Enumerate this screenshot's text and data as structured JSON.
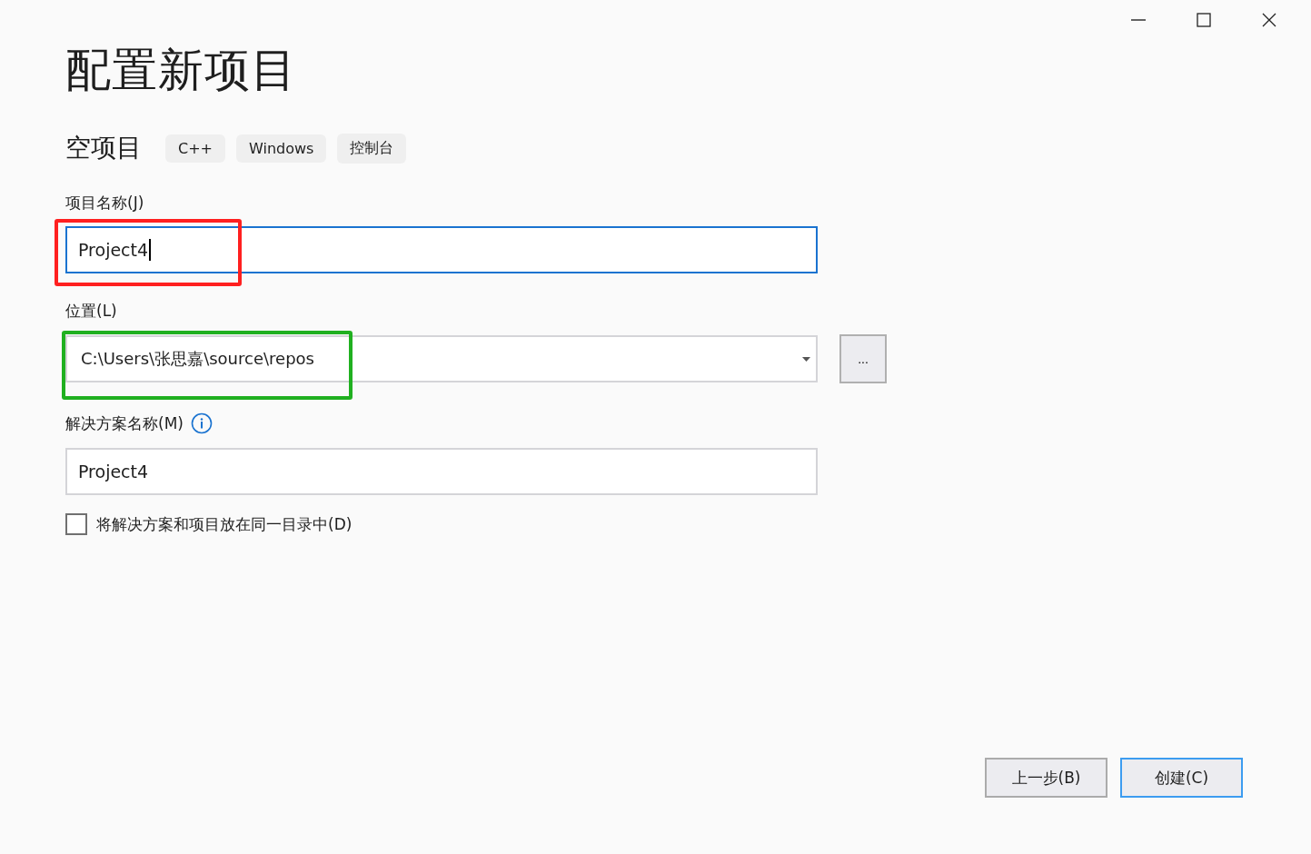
{
  "window": {
    "title": "配置新项目"
  },
  "template": {
    "name": "空项目",
    "tags": [
      "C++",
      "Windows",
      "控制台"
    ]
  },
  "project_name": {
    "label": "项目名称(J)",
    "value": "Project4",
    "focused": true
  },
  "location": {
    "label": "位置(L)",
    "value": "C:\\Users\\张思嘉\\source\\repos",
    "browse": "..."
  },
  "solution_name": {
    "label": "解决方案名称(M)",
    "value": "Project4"
  },
  "same_directory": {
    "label": "将解决方案和项目放在同一目录中(D)",
    "checked": false
  },
  "highlights": [
    {
      "color": "#ff2020"
    },
    {
      "color": "#20b020"
    }
  ],
  "buttons": [
    {
      "label": "上一步(B)",
      "default": false
    },
    {
      "label": "创建(C)",
      "default": true
    }
  ]
}
